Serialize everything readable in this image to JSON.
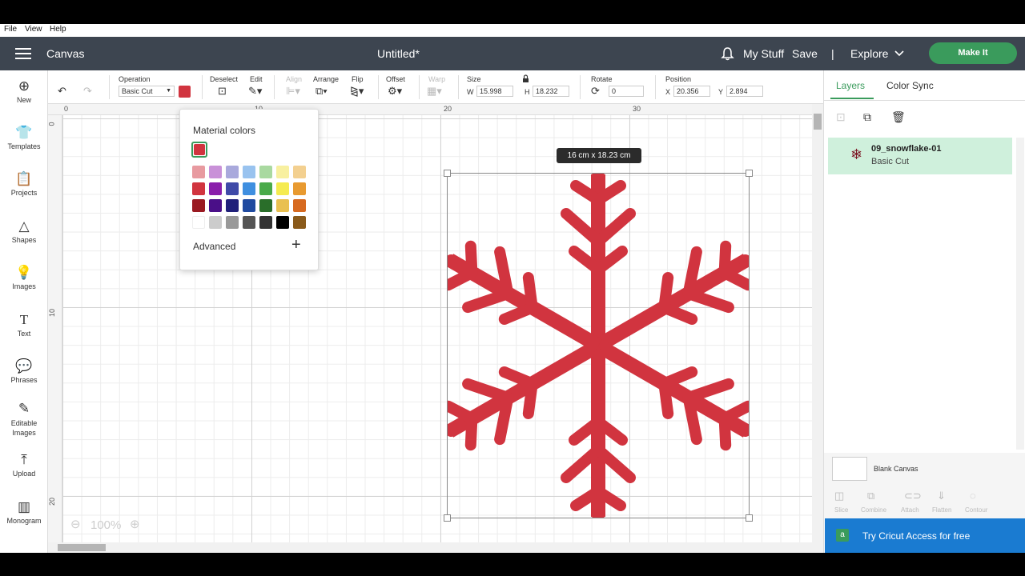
{
  "menubar": {
    "file": "File",
    "view": "View",
    "help": "Help"
  },
  "topbar": {
    "title": "Canvas",
    "doc_title": "Untitled*",
    "my_stuff": "My Stuff",
    "save": "Save",
    "divider": "|",
    "explore": "Explore",
    "make_it": "Make It"
  },
  "toolbar": {
    "operation_label": "Operation",
    "operation_value": "Basic Cut",
    "operation_color": "#d1343f",
    "deselect": "Deselect",
    "edit": "Edit",
    "align": "Align",
    "arrange": "Arrange",
    "flip": "Flip",
    "offset": "Offset",
    "warp": "Warp",
    "size_label": "Size",
    "w_label": "W",
    "w_value": "15.998",
    "h_label": "H",
    "h_value": "18.232",
    "rotate_label": "Rotate",
    "rotate_value": "0",
    "position_label": "Position",
    "x_label": "X",
    "x_value": "20.356",
    "y_label": "Y",
    "y_value": "2.894"
  },
  "sidebar": {
    "items": [
      {
        "label": "New",
        "icon": "plus-circle-icon"
      },
      {
        "label": "Templates",
        "icon": "shirt-icon"
      },
      {
        "label": "Projects",
        "icon": "clipboard-icon"
      },
      {
        "label": "Shapes",
        "icon": "shapes-icon"
      },
      {
        "label": "Images",
        "icon": "bulb-icon"
      },
      {
        "label": "Text",
        "icon": "text-icon"
      },
      {
        "label": "Phrases",
        "icon": "speech-bubble-icon"
      },
      {
        "label": "Editable Images",
        "icon": "edit-image-icon"
      },
      {
        "label": "Upload",
        "icon": "upload-icon"
      },
      {
        "label": "Monogram",
        "icon": "monogram-icon"
      }
    ]
  },
  "ruler": {
    "top": [
      "0",
      "10",
      "20",
      "30"
    ],
    "left": [
      "0",
      "10",
      "20"
    ]
  },
  "color_popup": {
    "title": "Material colors",
    "selected": "#d1343f",
    "rows": [
      [
        "#e89aa0",
        "#c991d8",
        "#a9a9dc",
        "#99c3ef",
        "#a9d9a0",
        "#f8f0a0",
        "#f3d090"
      ],
      [
        "#d1343f",
        "#8a1eab",
        "#3f4aa8",
        "#3f8fe0",
        "#4aaa4a",
        "#f5eb50",
        "#e89a30"
      ],
      [
        "#9a1a22",
        "#4a0f88",
        "#20207a",
        "#1f4aa0",
        "#2a6e2a",
        "#e9c050",
        "#d76a20"
      ],
      [
        "#ffffff",
        "#cccccc",
        "#999999",
        "#555555",
        "#333333",
        "#000000",
        "#8a5a1a"
      ]
    ],
    "advanced": "Advanced"
  },
  "canvas": {
    "size_tip": "16  cm x 18.23  cm",
    "zoom": "100%",
    "snowflake_color": "#d1343f"
  },
  "rightpanel": {
    "tab_layers": "Layers",
    "tab_color_sync": "Color Sync",
    "layer_name": "09_snowflake-01",
    "layer_op": "Basic Cut",
    "blank_canvas": "Blank Canvas",
    "actions": [
      "Slice",
      "Combine",
      "Attach",
      "Flatten",
      "Contour"
    ],
    "cricut_access": "Try Cricut Access for free"
  }
}
